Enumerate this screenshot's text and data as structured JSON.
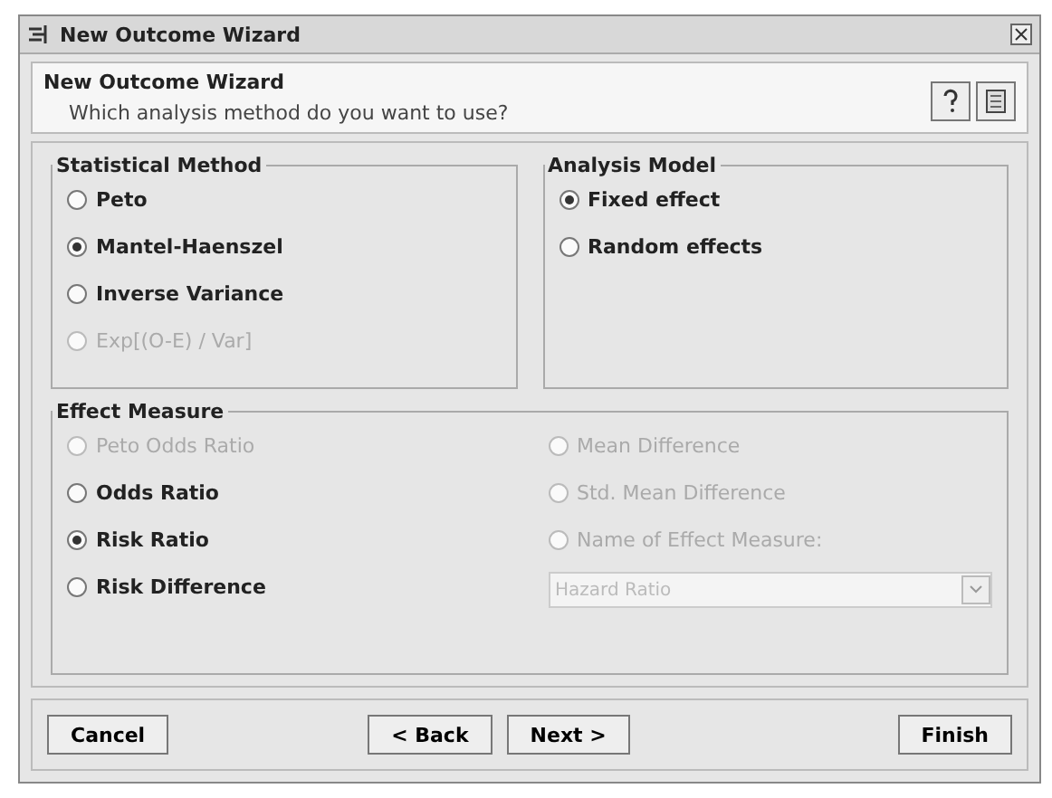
{
  "window": {
    "title": "New Outcome Wizard"
  },
  "header": {
    "title": "New Outcome Wizard",
    "subtitle": "Which analysis method do you want to use?"
  },
  "statistical_method": {
    "title": "Statistical Method",
    "options": [
      {
        "label": "Peto",
        "selected": false,
        "disabled": false
      },
      {
        "label": "Mantel-Haenszel",
        "selected": true,
        "disabled": false
      },
      {
        "label": "Inverse Variance",
        "selected": false,
        "disabled": false
      },
      {
        "label": "Exp[(O-E) / Var]",
        "selected": false,
        "disabled": true
      }
    ]
  },
  "analysis_model": {
    "title": "Analysis Model",
    "options": [
      {
        "label": "Fixed effect",
        "selected": true,
        "disabled": false
      },
      {
        "label": "Random effects",
        "selected": false,
        "disabled": false
      }
    ]
  },
  "effect_measure": {
    "title": "Effect Measure",
    "left_options": [
      {
        "label": "Peto Odds Ratio",
        "selected": false,
        "disabled": true
      },
      {
        "label": "Odds Ratio",
        "selected": false,
        "disabled": false
      },
      {
        "label": "Risk Ratio",
        "selected": true,
        "disabled": false
      },
      {
        "label": "Risk Difference",
        "selected": false,
        "disabled": false
      }
    ],
    "right_options": [
      {
        "label": "Mean Difference",
        "selected": false,
        "disabled": true
      },
      {
        "label": "Std. Mean Difference",
        "selected": false,
        "disabled": true
      },
      {
        "label": "Name of Effect Measure:",
        "selected": false,
        "disabled": true
      }
    ],
    "name_field": {
      "value": "Hazard Ratio",
      "disabled": true
    }
  },
  "buttons": [
    {
      "label": "Cancel",
      "kind": "left"
    },
    {
      "label": "< Back",
      "kind": "middle"
    },
    {
      "label": "Next >",
      "kind": "middle"
    },
    {
      "label": "Finish",
      "kind": "right"
    }
  ]
}
